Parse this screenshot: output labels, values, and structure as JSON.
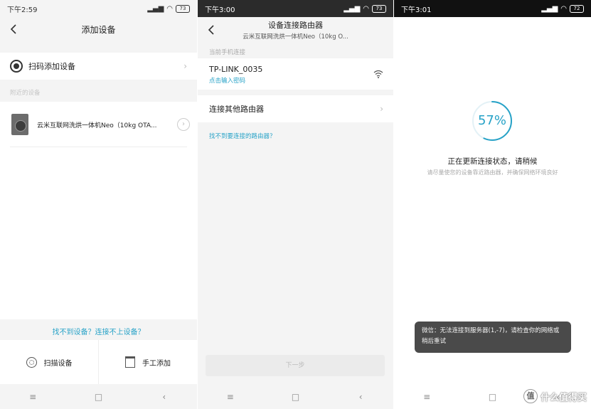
{
  "screen1": {
    "status": {
      "time": "下午2:59",
      "battery": "73"
    },
    "nav": {
      "title": "添加设备"
    },
    "scan_add_label": "扫码添加设备",
    "nearby_label": "附近的设备",
    "device_name": "云米互联网洗烘一体机Neo（10kg OTA...",
    "help_link": "找不到设备？连接不上设备？",
    "buttons": {
      "scan": "扫描设备",
      "manual": "手工添加"
    }
  },
  "screen2": {
    "status": {
      "time": "下午3:00",
      "battery": "73"
    },
    "nav": {
      "title": "设备连接路由器",
      "subtitle": "云米互联网洗烘一体机Neo（10kg O..."
    },
    "current_label": "当前手机连接",
    "wifi": {
      "name": "TP-LINK_0035",
      "hint": "点击输入密码"
    },
    "other_router": "连接其他路由器",
    "cant_find": "找不到要连接的路由器？",
    "next_button": "下一步"
  },
  "screen3": {
    "status": {
      "time": "下午3:01",
      "battery": "72"
    },
    "progress": {
      "percent": 57,
      "label": "57%"
    },
    "title": "正在更新连接状态，请稍候",
    "subtitle": "请尽量使您的设备靠近路由器，并确保网络环境良好",
    "toast": "微信：无法连接到服务器(1,-7)，请检查你的网络或稍后重试",
    "watermark": "什么值得买",
    "watermark_badge": "值"
  },
  "colors": {
    "accent": "#27a2c7",
    "toast_bg": "#4a4a4a"
  },
  "icons": [
    "back-icon",
    "scan-ring-icon",
    "chevron-right-icon",
    "wifi-icon",
    "signal-icon",
    "menu-icon",
    "home-icon",
    "back-triangle-icon"
  ]
}
